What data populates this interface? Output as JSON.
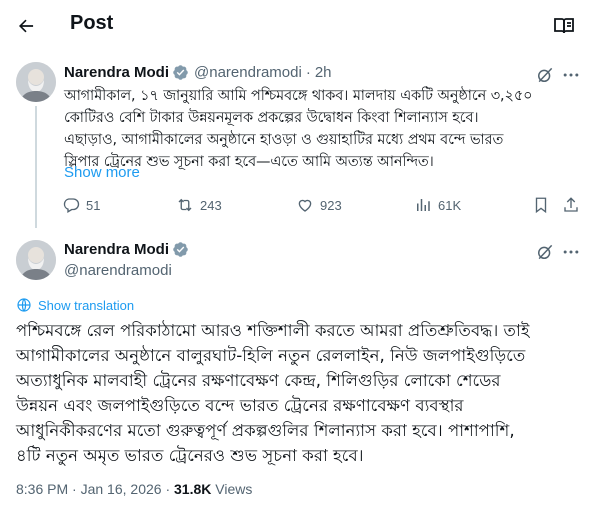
{
  "header": {
    "title": "Post",
    "back_icon": "arrow-left-icon",
    "reader_icon": "reader-mode-icon"
  },
  "colors": {
    "accent": "#1d9bf0",
    "text": "#0f1419",
    "muted": "#536471",
    "verified": "#829aab",
    "divider": "#cfd9de"
  },
  "tweet1": {
    "author_name": "Narendra Modi",
    "handle": "@narendramodi",
    "separator": "·",
    "time": "2h",
    "text_lines": [
      "আগামীকাল, ১৭ জানুয়ারি আমি পশ্চিমবঙ্গে থাকব। মালদায় একটি অনুষ্ঠানে ৩,২৫০",
      "কোটিরও বেশি টাকার উন্নয়নমূলক প্রকল্পের উদ্বোধন কিংবা শিলান্যাস হবে।",
      "এছাড়াও, আগামীকালের অনুষ্ঠানে হাওড়া ও গুয়াহাটির মধ্যে প্রথম বন্দে ভারত",
      "স্লিপার ট্রেনের শুভ সূচনা করা হবে—এতে আমি অত্যন্ত আনন্দিত।"
    ],
    "show_more": "Show more",
    "actions": {
      "replies": "51",
      "reposts": "243",
      "likes": "923",
      "views": "61K"
    }
  },
  "tweet2": {
    "author_name": "Narendra Modi",
    "handle": "@narendramodi",
    "show_translation": "Show translation",
    "text_lines": [
      "পশ্চিমবঙ্গে রেল পরিকাঠামো আরও শক্তিশালী করতে আমরা প্রতিশ্রুতিবদ্ধ। তাই",
      "আগামীকালের অনুষ্ঠানে বালুরঘাট-হিলি নতুন রেললাইন, নিউ জলপাইগুড়িতে",
      "অত্যাধুনিক মালবাহী ট্রেনের রক্ষণাবেক্ষণ কেন্দ্র, শিলিগুড়ির লোকো শেডের",
      "উন্নয়ন এবং জলপাইগুড়িতে বন্দে ভারত ট্রেনের রক্ষণাবেক্ষণ ব্যবস্থার",
      "আধুনিকীকরণের মতো গুরুত্বপূর্ণ প্রকল্পগুলির শিলান্যাস করা হবে। পাশাপাশি,",
      "৪টি নতুন অমৃত ভারত ট্রেনেরও শুভ সূচনা করা হবে।"
    ],
    "time": "8:36 PM",
    "date": "Jan 16, 2026",
    "separator": "·",
    "views_count": "31.8K",
    "views_label": "Views"
  }
}
